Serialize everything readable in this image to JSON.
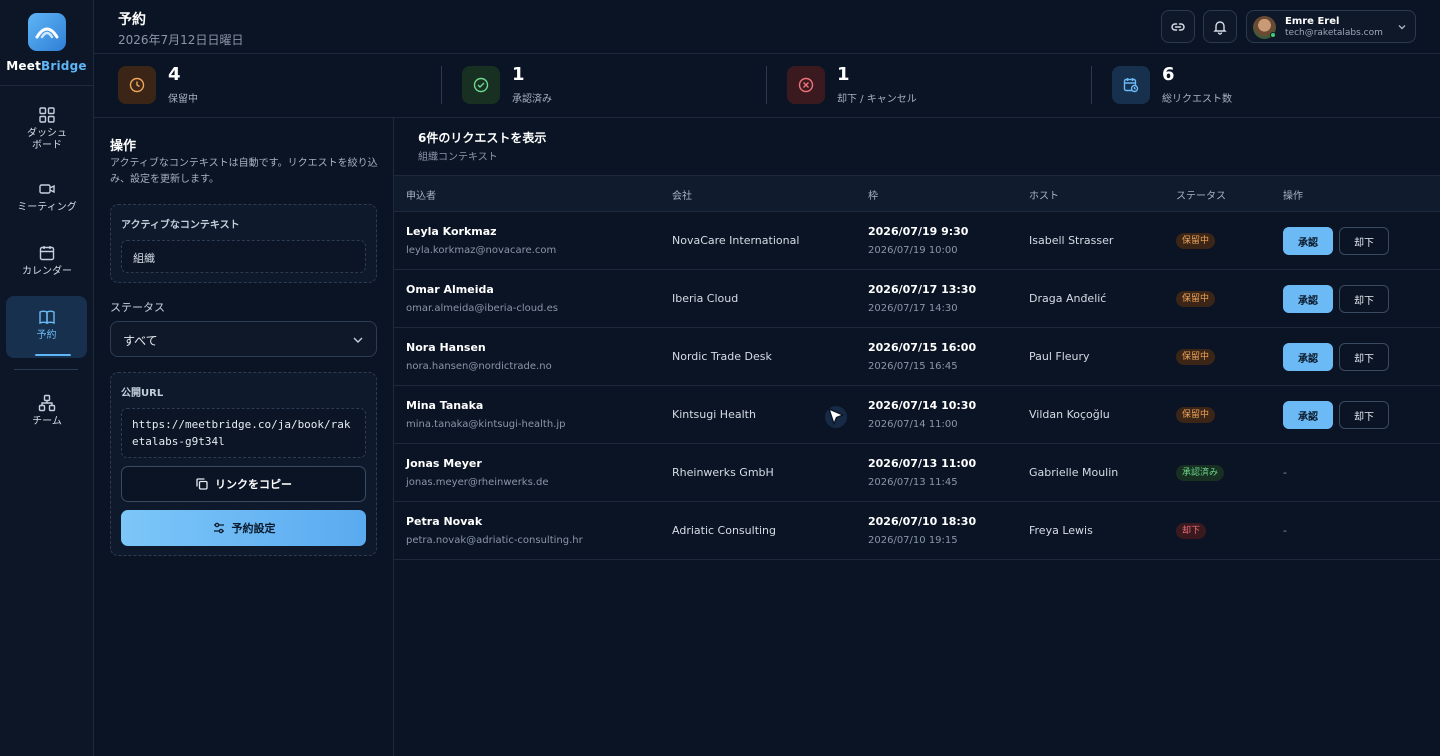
{
  "app": {
    "brand_part1": "Meet",
    "brand_part2": "Bridge"
  },
  "sidebar": {
    "items": [
      {
        "label_line1": "ダッシュ",
        "label_line2": "ボード",
        "icon": "grid-icon"
      },
      {
        "label": "ミーティング",
        "icon": "video-icon"
      },
      {
        "label": "カレンダー",
        "icon": "calendar-icon"
      },
      {
        "label": "予約",
        "icon": "book-icon",
        "active": true
      },
      {
        "label": "チーム",
        "icon": "team-icon"
      }
    ]
  },
  "header": {
    "title": "予約",
    "date": "2026年7月12日日曜日",
    "user_name": "Emre Erel",
    "user_email": "tech@raketalabs.com"
  },
  "stats": [
    {
      "value": "4",
      "label": "保留中",
      "color": "#f2a55c"
    },
    {
      "value": "1",
      "label": "承認済み",
      "color": "#6dd88e"
    },
    {
      "value": "1",
      "label": "却下 / キャンセル",
      "color": "#f0727a"
    },
    {
      "value": "6",
      "label": "総リクエスト数",
      "color": "#6cbaf5"
    }
  ],
  "panel": {
    "title": "操作",
    "description": "アクティブなコンテキストは自動です。リクエストを絞り込み、設定を更新します。",
    "context_label": "アクティブなコンテキスト",
    "context_value": "組織",
    "status_label": "ステータス",
    "status_value": "すべて",
    "public_url_label": "公開URL",
    "public_url": "https://meetbridge.co/ja/book/raketalabs-g9t34l",
    "copy_link": "リンクをコピー",
    "booking_settings": "予約設定"
  },
  "main": {
    "title": "6件のリクエストを表示",
    "subtitle": "組織コンテキスト",
    "columns": [
      "申込者",
      "会社",
      "枠",
      "ホスト",
      "ステータス",
      "操作"
    ],
    "approve_label": "承認",
    "reject_label": "却下",
    "rows": [
      {
        "name": "Leyla Korkmaz",
        "email": "leyla.korkmaz@novacare.com",
        "company": "NovaCare International",
        "start": "2026/07/19 9:30",
        "end": "2026/07/19 10:00",
        "host": "Isabell Strasser",
        "status": "保留中",
        "status_type": "pending",
        "actions": true
      },
      {
        "name": "Omar Almeida",
        "email": "omar.almeida@iberia-cloud.es",
        "company": "Iberia Cloud",
        "start": "2026/07/17 13:30",
        "end": "2026/07/17 14:30",
        "host": "Draga Anđelić",
        "status": "保留中",
        "status_type": "pending",
        "actions": true
      },
      {
        "name": "Nora Hansen",
        "email": "nora.hansen@nordictrade.no",
        "company": "Nordic Trade Desk",
        "start": "2026/07/15 16:00",
        "end": "2026/07/15 16:45",
        "host": "Paul Fleury",
        "status": "保留中",
        "status_type": "pending",
        "actions": true
      },
      {
        "name": "Mina Tanaka",
        "email": "mina.tanaka@kintsugi-health.jp",
        "company": "Kintsugi Health",
        "start": "2026/07/14 10:30",
        "end": "2026/07/14 11:00",
        "host": "Vildan Koçoğlu",
        "status": "保留中",
        "status_type": "pending",
        "actions": true
      },
      {
        "name": "Jonas Meyer",
        "email": "jonas.meyer@rheinwerks.de",
        "company": "Rheinwerks GmbH",
        "start": "2026/07/13 11:00",
        "end": "2026/07/13 11:45",
        "host": "Gabrielle Moulin",
        "status": "承認済み",
        "status_type": "approved",
        "actions": false,
        "no_action": "-"
      },
      {
        "name": "Petra Novak",
        "email": "petra.novak@adriatic-consulting.hr",
        "company": "Adriatic Consulting",
        "start": "2026/07/10 18:30",
        "end": "2026/07/10 19:15",
        "host": "Freya Lewis",
        "status": "却下",
        "status_type": "rejected",
        "actions": false,
        "no_action": "-"
      }
    ]
  }
}
